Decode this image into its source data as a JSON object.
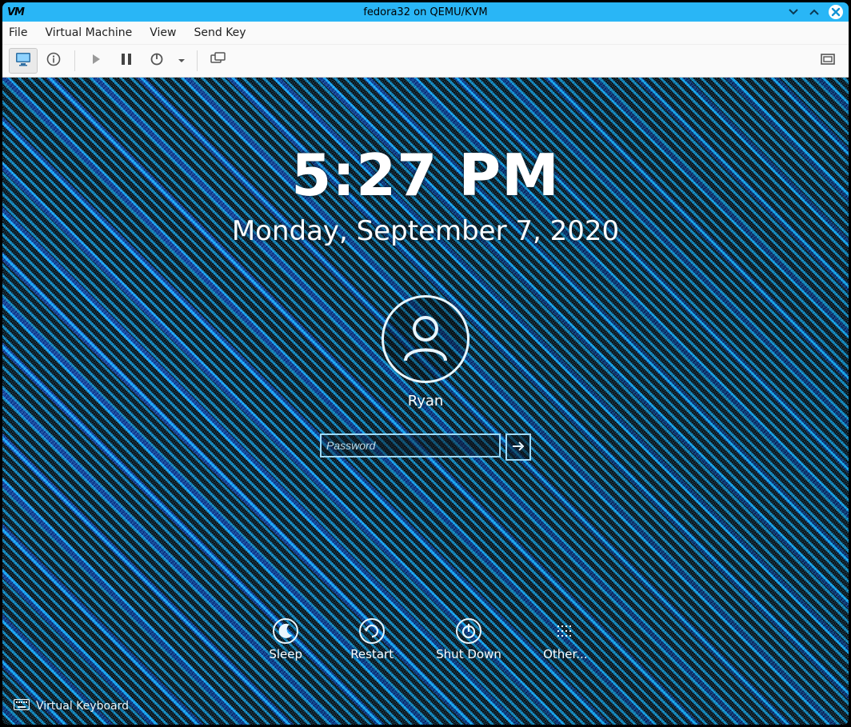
{
  "titlebar": {
    "logo_text": "VM",
    "title": "fedora32 on QEMU/KVM"
  },
  "menubar": {
    "items": [
      "File",
      "Virtual Machine",
      "View",
      "Send Key"
    ]
  },
  "toolbar_icons": {
    "console": "monitor-icon",
    "details": "info-icon",
    "play": "play-icon",
    "pause": "pause-icon",
    "power": "power-icon",
    "power_menu": "chevron-down-icon",
    "snapshots": "snapshots-icon",
    "fullscreen": "fullscreen-icon"
  },
  "lockscreen": {
    "time": "5:27 PM",
    "date": "Monday, September 7, 2020",
    "username": "Ryan",
    "password_placeholder": "Password",
    "password_value": "",
    "actions": {
      "sleep": "Sleep",
      "restart": "Restart",
      "shutdown": "Shut Down",
      "other": "Other..."
    },
    "virtual_keyboard": "Virtual Keyboard"
  }
}
